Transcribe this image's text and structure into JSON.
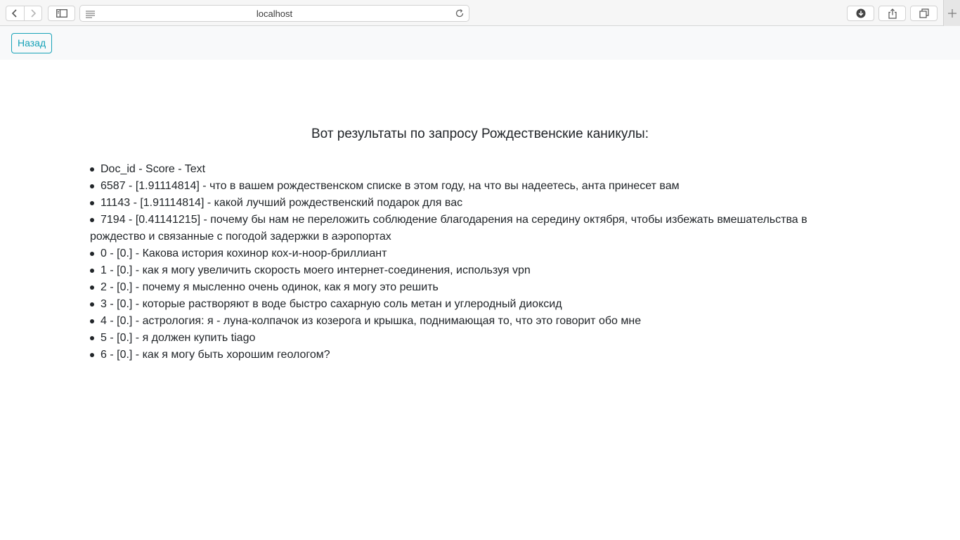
{
  "browser": {
    "url": "localhost"
  },
  "header": {
    "back_label": "Назад"
  },
  "main": {
    "heading": "Вот результаты по запросу Рождественские каникулы:",
    "results": [
      "Doc_id - Score - Text",
      "6587 - [1.91114814] - что в вашем рождественском списке в этом году, на что вы надеетесь, анта принесет вам",
      "11143 - [1.91114814] - какой лучший рождественский подарок для вас",
      "7194 - [0.41141215] - почему бы нам не переложить соблюдение благодарения на середину октября, чтобы избежать вмешательства в рождество и связанные с погодой задержки в аэропортах",
      "0 - [0.] - Какова история кохинор кох-и-ноор-бриллиант",
      "1 - [0.] - как я могу увеличить скорость моего интернет-соединения, используя vpn",
      "2 - [0.] - почему я мысленно очень одинок, как я могу это решить",
      "3 - [0.] - которые растворяют в воде быстро сахарную соль метан и углеродный диоксид",
      "4 - [0.] - астрология: я - луна-колпачок из козерога и крышка, поднимающая то, что это говорит обо мне",
      "5 - [0.] - я должен купить tiago",
      "6 - [0.] - как я могу быть хорошим геологом?"
    ]
  },
  "colors": {
    "accent": "#17a2b8",
    "header_bg": "#f8f9fa",
    "text": "#212529"
  },
  "icons": [
    "back-arrow-icon",
    "forward-arrow-icon",
    "sidebar-icon",
    "reader-icon",
    "reload-icon",
    "download-icon",
    "share-icon",
    "tabs-icon",
    "new-tab-icon"
  ]
}
